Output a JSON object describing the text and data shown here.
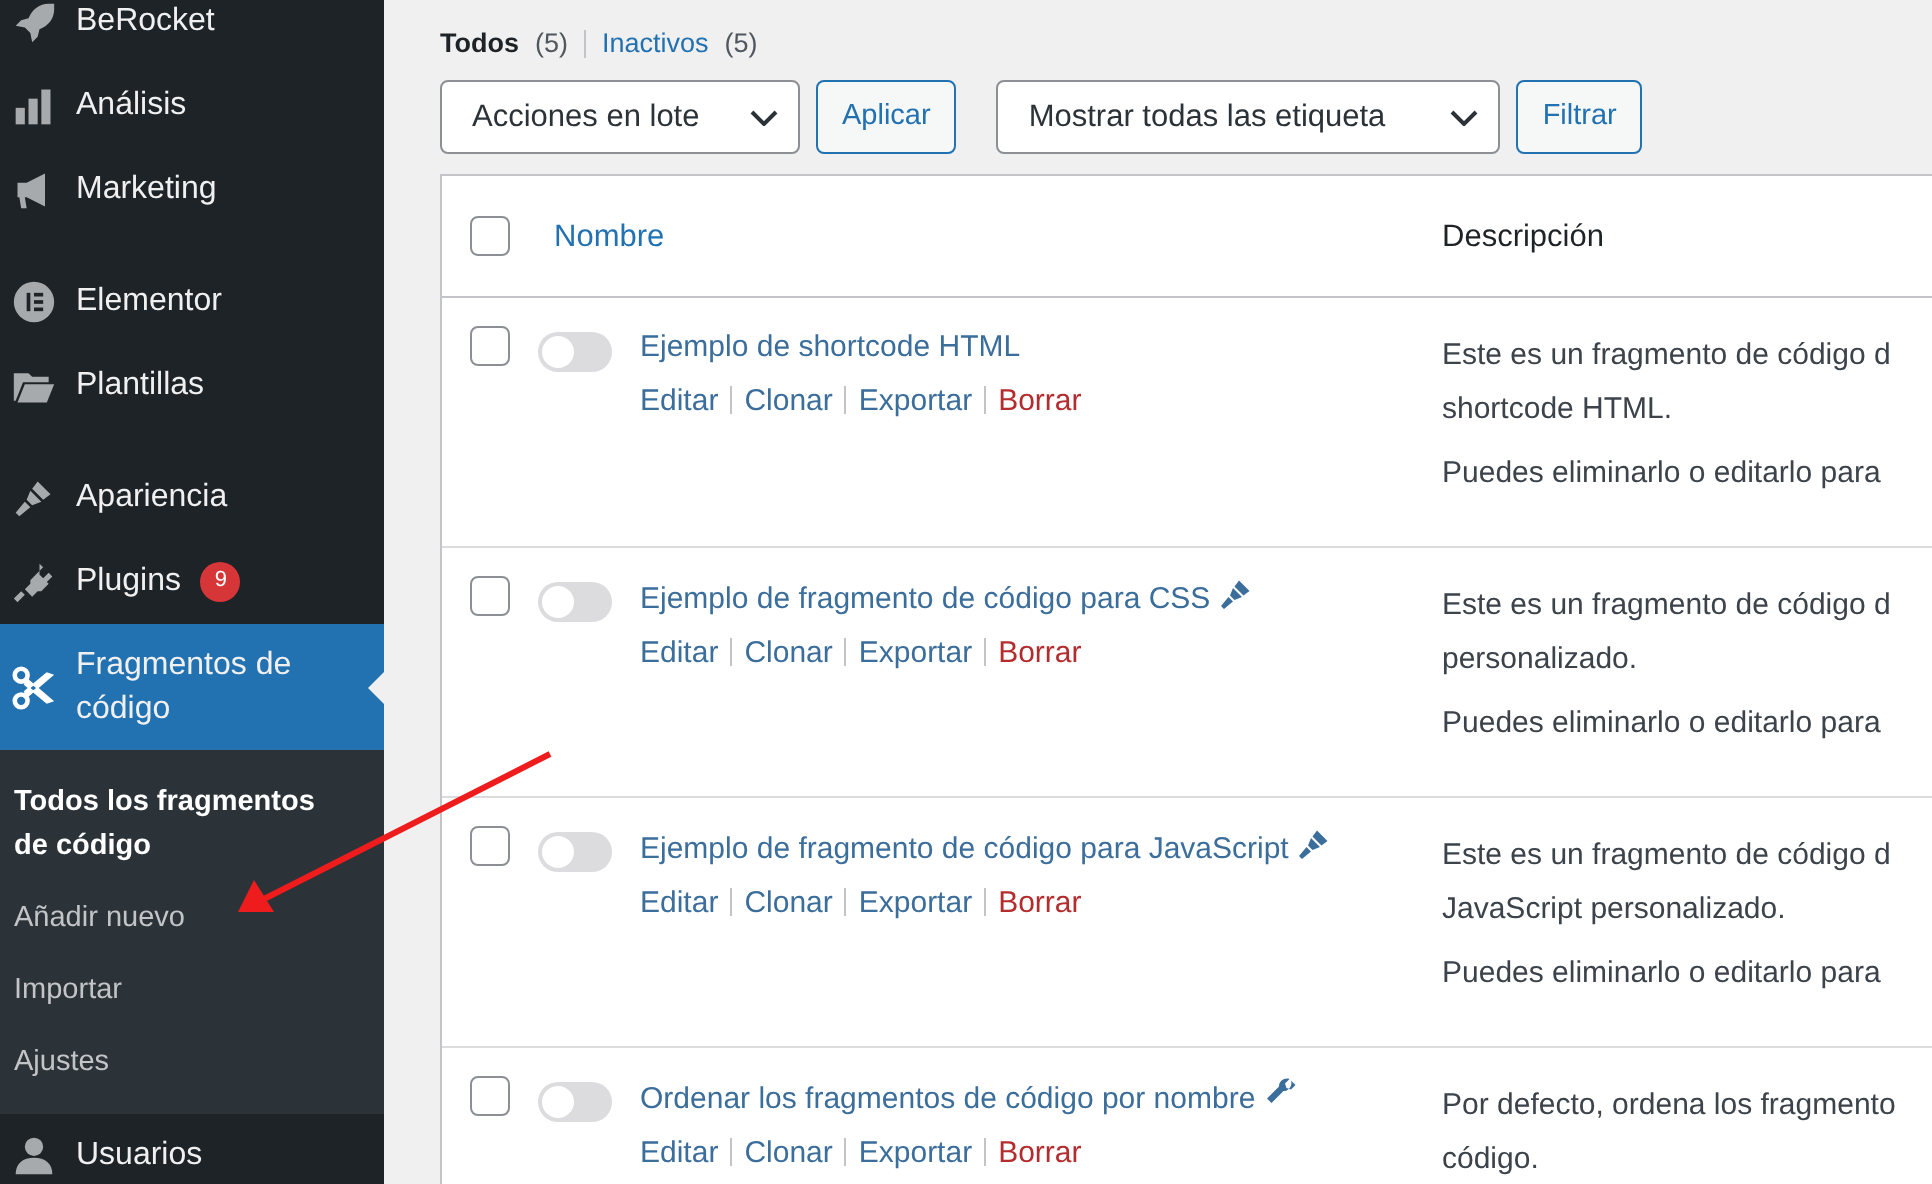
{
  "sidebar": {
    "items": [
      {
        "label": "BeRocket",
        "kind": "rocket",
        "selected": false
      },
      {
        "label": "Análisis",
        "kind": "bars",
        "selected": false
      },
      {
        "label": "Marketing",
        "kind": "megaphone",
        "selected": false
      },
      {
        "kind": "separator"
      },
      {
        "label": "Elementor",
        "kind": "elementor",
        "selected": false
      },
      {
        "label": "Plantillas",
        "kind": "folder",
        "selected": false
      },
      {
        "kind": "separator"
      },
      {
        "label": "Apariencia",
        "kind": "brush",
        "selected": false
      },
      {
        "label": "Plugins",
        "kind": "plug",
        "selected": false,
        "badge": "9"
      },
      {
        "label": "Fragmentos de código",
        "kind": "scissors",
        "selected": true,
        "children": [
          {
            "label": "Todos los fragmentos de código",
            "selected": true
          },
          {
            "label": "Añadir nuevo",
            "selected": false
          },
          {
            "label": "Importar",
            "selected": false
          },
          {
            "label": "Ajustes",
            "selected": false
          }
        ]
      },
      {
        "label": "Usuarios",
        "kind": "user",
        "selected": false
      }
    ]
  },
  "views": [
    {
      "label": "Todos",
      "count": "(5)",
      "selected": true
    },
    {
      "label": "Inactivos",
      "count": "(5)",
      "selected": false
    }
  ],
  "bulk_actions": {
    "value": "Acciones en lote",
    "button": "Aplicar"
  },
  "tag_filter": {
    "value": "Mostrar todas las etiqueta",
    "button": "Filtrar"
  },
  "table": {
    "select_all_checked": false,
    "columns": [
      "Nombre",
      "Descripción"
    ],
    "rows": [
      {
        "name": "Ejemplo de shortcode HTML",
        "kind": "html",
        "checked": false,
        "active": false,
        "actions": [
          "Editar",
          "Clonar",
          "Exportar",
          "Borrar"
        ],
        "description": [
          "Este es un fragmento de código d",
          "shortcode HTML."
        ],
        "note": "Puedes eliminarlo o editarlo para"
      },
      {
        "name": "Ejemplo de fragmento de código para CSS",
        "kind": "css",
        "checked": false,
        "active": false,
        "actions": [
          "Editar",
          "Clonar",
          "Exportar",
          "Borrar"
        ],
        "description": [
          "Este es un fragmento de código d",
          "personalizado."
        ],
        "note": "Puedes eliminarlo o editarlo para"
      },
      {
        "name": "Ejemplo de fragmento de código para JavaScript",
        "kind": "js",
        "checked": false,
        "active": false,
        "actions": [
          "Editar",
          "Clonar",
          "Exportar",
          "Borrar"
        ],
        "description": [
          "Este es un fragmento de código d",
          "JavaScript personalizado."
        ],
        "note": "Puedes eliminarlo o editarlo para"
      },
      {
        "name": "Ordenar los fragmentos de código por nombre",
        "kind": "php",
        "checked": false,
        "active": false,
        "actions": [
          "Editar",
          "Clonar",
          "Exportar",
          "Borrar"
        ],
        "description": [
          "Por defecto, ordena los fragmento",
          "código."
        ]
      }
    ]
  }
}
